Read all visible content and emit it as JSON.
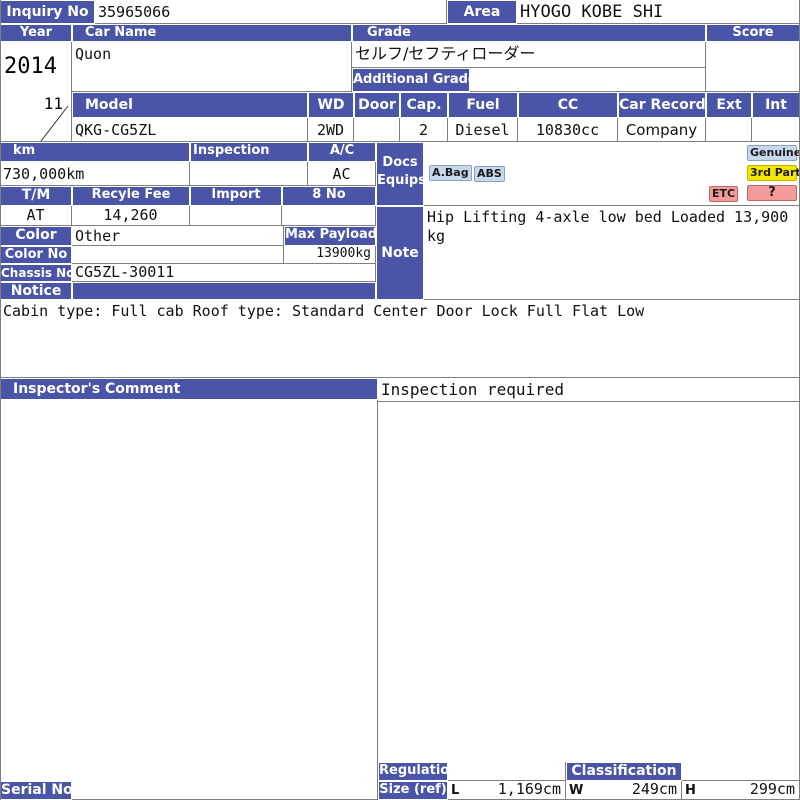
{
  "labels": {
    "inquiry_no": "Inquiry No",
    "area": "Area",
    "year": "Year",
    "car_name": "Car Name",
    "grade": "Grade",
    "score": "Score",
    "additional_grade": "Additional Grade",
    "model": "Model",
    "wd": "WD",
    "door": "Door",
    "cap": "Cap.",
    "fuel": "Fuel",
    "cc": "CC",
    "car_record": "Car Record",
    "ext": "Ext",
    "int": "Int",
    "km": "km",
    "inspection": "Inspection",
    "ac": "A/C",
    "docs": "Docs",
    "equips": "Equips",
    "tm": "T/M",
    "recycle_fee": "Recyle Fee",
    "import": "Import",
    "eight_no": "8 No",
    "color": "Color",
    "max_payload": "Max Payload",
    "color_no": "Color No",
    "note": "Note",
    "chassis_no": "Chassis No",
    "notice": "Notice",
    "inspectors_comment": "Inspector's Comment",
    "regulation": "Regulation",
    "size_ref": "Size (ref)",
    "classification": "Classification",
    "serial_no": "Serial No",
    "dim_l": "L",
    "dim_w": "W",
    "dim_h": "H"
  },
  "values": {
    "inquiry_no": "35965066",
    "area": "HYOGO KOBE SHI",
    "year": "2014",
    "month": "11",
    "car_name": "Quon",
    "grade": "セルフ/セフティローダー",
    "additional_grade": "",
    "score": "",
    "model": "QKG-CG5ZL",
    "wd": "2WD",
    "door": "",
    "cap": "2",
    "fuel": "Diesel",
    "cc": "10830cc",
    "car_record": "Company",
    "ext": "",
    "int": "",
    "km": "730,000km",
    "inspection": "",
    "ac": "AC",
    "tm": "AT",
    "recycle_fee": "14,260",
    "import": "",
    "eight_no": "",
    "color": "Other",
    "max_payload": "13900kg",
    "color_no": "",
    "chassis_no": "CG5ZL-30011",
    "note": "Hip Lifting 4-axle low bed Loaded 13,900 kg",
    "notice": "Cabin type: Full cab Roof type: Standard Center Door Lock Full Flat Low",
    "inspector_comment_right": "Inspection required",
    "size_l": "1,169cm",
    "size_w": "249cm",
    "size_h": "299cm",
    "serial_no": ""
  },
  "equip_badges": {
    "abag": "A.Bag",
    "abs": "ABS",
    "etc": "ETC",
    "genuine": "Genuine",
    "third_party": "3rd Party",
    "unknown": "?"
  },
  "colors": {
    "header_blue": "#4a55a8",
    "badge_blue": "#c8d8ec",
    "badge_yellow": "#f3e600",
    "badge_pink": "#f39a9a"
  }
}
